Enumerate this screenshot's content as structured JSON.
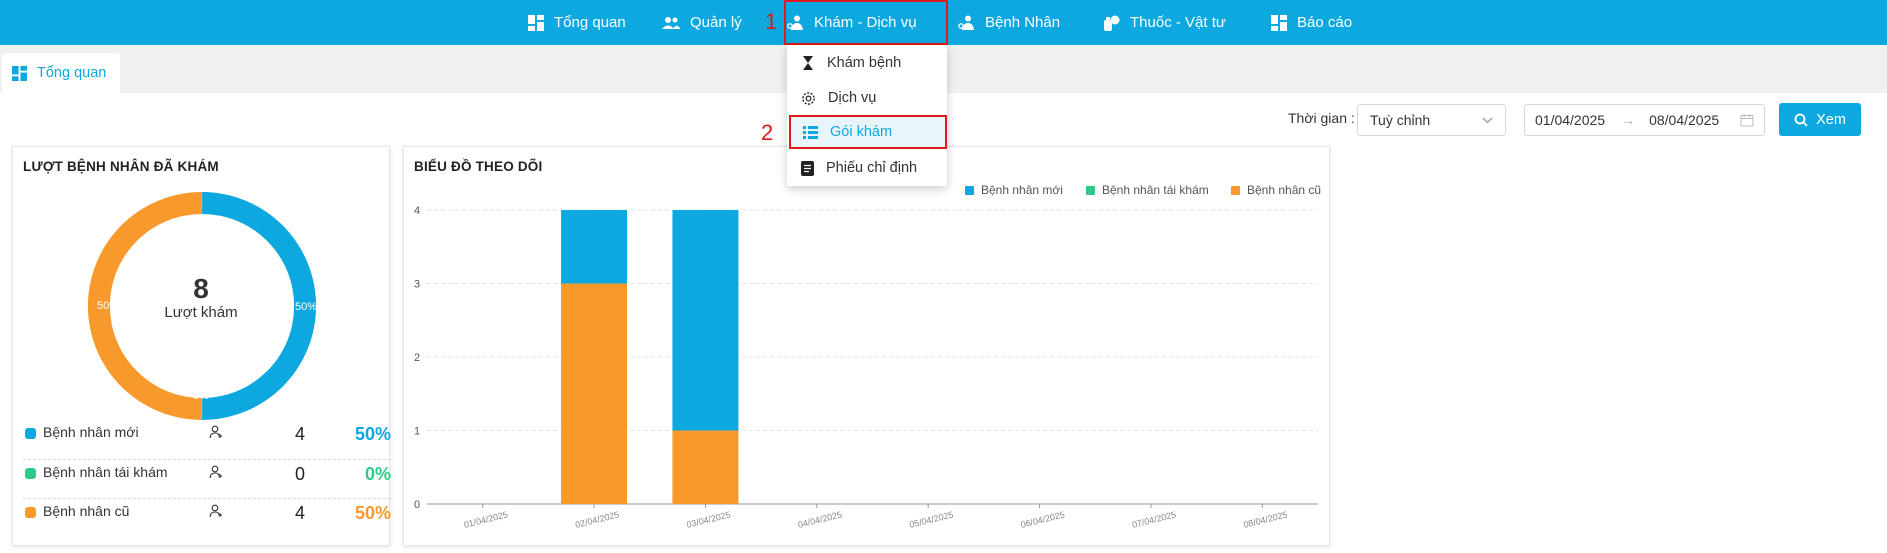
{
  "nav": {
    "items": [
      {
        "label": "Tổng quan"
      },
      {
        "label": "Quản lý"
      },
      {
        "label": "Khám - Dịch vụ"
      },
      {
        "label": "Bệnh Nhân"
      },
      {
        "label": "Thuốc - Vật tư"
      },
      {
        "label": "Báo cáo"
      }
    ]
  },
  "annotations": {
    "one": "1",
    "two": "2"
  },
  "dropdown": {
    "items": [
      {
        "label": "Khám bệnh"
      },
      {
        "label": "Dịch vụ"
      },
      {
        "label": "Gói khám"
      },
      {
        "label": "Phiếu chỉ định"
      }
    ]
  },
  "tab": {
    "label": "Tổng quan"
  },
  "filter": {
    "time_label": "Thời gian :",
    "select_value": "Tuỳ chỉnh",
    "date_from": "01/04/2025",
    "date_to": "08/04/2025",
    "arrow": "→",
    "view_button": "Xem"
  },
  "visits_card": {
    "title": "LƯỢT BỆNH NHÂN ĐÃ KHÁM",
    "total": "8",
    "total_label": "Lượt khám",
    "slice_labels": {
      "new": "50%",
      "old": "50%",
      "revisit": "0%"
    },
    "rows": [
      {
        "name": "Bệnh nhân mới",
        "count": "4",
        "percent": "50%",
        "color": "#0da8e0"
      },
      {
        "name": "Bệnh nhân tái khám",
        "count": "0",
        "percent": "0%",
        "color": "#2dc98a"
      },
      {
        "name": "Bệnh nhân cũ",
        "count": "4",
        "percent": "50%",
        "color": "#f7992b"
      }
    ]
  },
  "tracking_card": {
    "title": "BIỂU ĐỒ THEO DÕI",
    "legend": [
      {
        "name": "Bệnh nhân mới",
        "color": "#0da8e0"
      },
      {
        "name": "Bệnh nhân tái khám",
        "color": "#2dc98a"
      },
      {
        "name": "Bệnh nhân cũ",
        "color": "#f7992b"
      }
    ]
  },
  "chart_data": [
    {
      "type": "pie",
      "title": "LƯỢT BỆNH NHÂN ĐÃ KHÁM",
      "labels": [
        "Bệnh nhân mới",
        "Bệnh nhân tái khám",
        "Bệnh nhân cũ"
      ],
      "values": [
        4,
        0,
        4
      ],
      "percents": [
        "50%",
        "0%",
        "50%"
      ],
      "colors": [
        "#0da8e0",
        "#2dc98a",
        "#f7992b"
      ],
      "donut": true
    },
    {
      "type": "bar",
      "stacked": true,
      "title": "BIỂU ĐỒ THEO DÕI",
      "categories": [
        "01/04/2025",
        "02/04/2025",
        "03/04/2025",
        "04/04/2025",
        "05/04/2025",
        "06/04/2025",
        "07/04/2025",
        "08/04/2025"
      ],
      "series": [
        {
          "name": "Bệnh nhân cũ",
          "color": "#f7992b",
          "values": [
            0,
            3,
            1,
            0,
            0,
            0,
            0,
            0
          ]
        },
        {
          "name": "Bệnh nhân tái khám",
          "color": "#2dc98a",
          "values": [
            0,
            0,
            0,
            0,
            0,
            0,
            0,
            0
          ]
        },
        {
          "name": "Bệnh nhân mới",
          "color": "#0da8e0",
          "values": [
            0,
            1,
            3,
            0,
            0,
            0,
            0,
            0
          ]
        }
      ],
      "ylim": [
        0,
        4
      ],
      "yticks": [
        "0",
        "1",
        "2",
        "3",
        "4"
      ],
      "legend_position": "top-right",
      "grid": true
    }
  ]
}
